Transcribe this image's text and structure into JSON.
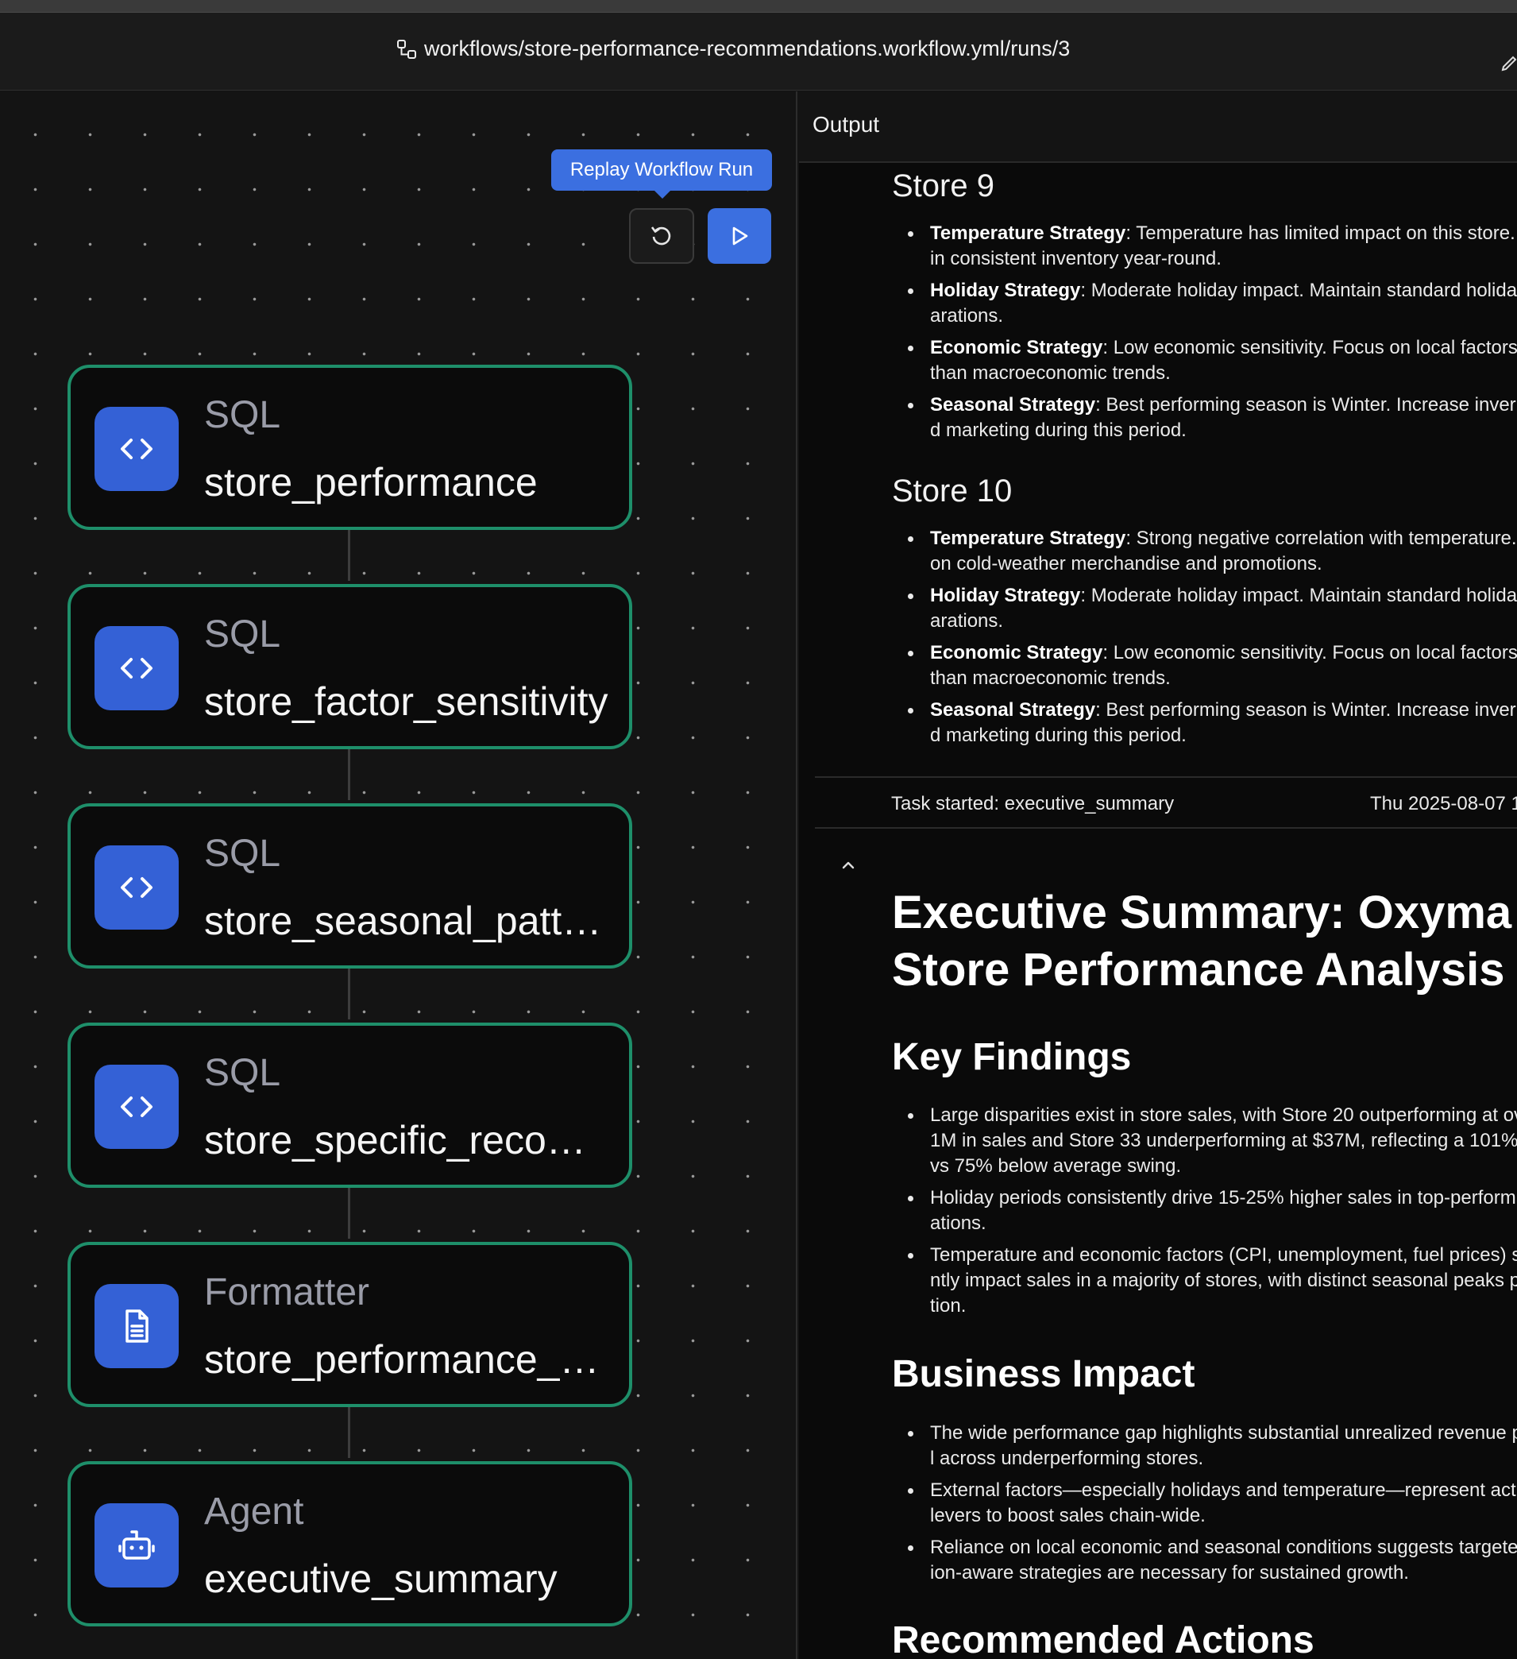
{
  "header": {
    "path": "workflows/store-performance-recommendations.workflow.yml/runs/3"
  },
  "toolbar": {
    "tooltip": "Replay Workflow Run"
  },
  "nodes": [
    {
      "kind": "SQL",
      "name": "store_performance",
      "icon": "code-icon"
    },
    {
      "kind": "SQL",
      "name": "store_factor_sensitivity",
      "icon": "code-icon"
    },
    {
      "kind": "SQL",
      "name": "store_seasonal_patt…",
      "icon": "code-icon"
    },
    {
      "kind": "SQL",
      "name": "store_specific_reco…",
      "icon": "code-icon"
    },
    {
      "kind": "Formatter",
      "name": "store_performance_…",
      "icon": "document-icon"
    },
    {
      "kind": "Agent",
      "name": "executive_summary",
      "icon": "robot-icon"
    }
  ],
  "output": {
    "title": "Output",
    "stores": [
      {
        "heading": "Store 9",
        "items": [
          {
            "label": "Temperature Strategy",
            "text": ": Temperature has limited impact on this store.",
            "cont": "in consistent inventory year-round."
          },
          {
            "label": "Holiday Strategy",
            "text": ": Moderate holiday impact. Maintain standard holida",
            "cont": "arations."
          },
          {
            "label": "Economic Strategy",
            "text": ": Low economic sensitivity. Focus on local factors",
            "cont": "than macroeconomic trends."
          },
          {
            "label": "Seasonal Strategy",
            "text": ": Best performing season is Winter. Increase inver",
            "cont": "d marketing during this period."
          }
        ]
      },
      {
        "heading": "Store 10",
        "items": [
          {
            "label": "Temperature Strategy",
            "text": ": Strong negative correlation with temperature.",
            "cont": "on cold-weather merchandise and promotions."
          },
          {
            "label": "Holiday Strategy",
            "text": ": Moderate holiday impact. Maintain standard holida",
            "cont": "arations."
          },
          {
            "label": "Economic Strategy",
            "text": ": Low economic sensitivity. Focus on local factors",
            "cont": "than macroeconomic trends."
          },
          {
            "label": "Seasonal Strategy",
            "text": ": Best performing season is Winter. Increase inver",
            "cont": "d marketing during this period."
          }
        ]
      }
    ],
    "task": {
      "text": "Task started: executive_summary",
      "time": "Thu 2025-08-07 1"
    },
    "summary": {
      "h1_line1": "Executive Summary: Oxyma",
      "h1_line2": "Store Performance Analysis",
      "sections": [
        {
          "heading": "Key Findings",
          "items": [
            [
              "Large disparities exist in store sales, with Store 20 outperforming at ov",
              "1M in sales and Store 33 underperforming at $37M, reflecting a 101%",
              "vs 75% below average swing."
            ],
            [
              "Holiday periods consistently drive 15-25% higher sales in top-perform",
              "ations."
            ],
            [
              "Temperature and economic factors (CPI, unemployment, fuel prices) s",
              "ntly impact sales in a majority of stores, with distinct seasonal peaks p",
              "tion."
            ]
          ]
        },
        {
          "heading": "Business Impact",
          "items": [
            [
              "The wide performance gap highlights substantial unrealized revenue p",
              "l across underperforming stores."
            ],
            [
              "External factors—especially holidays and temperature—represent act",
              "levers to boost sales chain-wide."
            ],
            [
              "Reliance on local economic and seasonal conditions suggests targete",
              "ion-aware strategies are necessary for sustained growth."
            ]
          ]
        },
        {
          "heading": "Recommended Actions",
          "items": []
        }
      ]
    }
  }
}
